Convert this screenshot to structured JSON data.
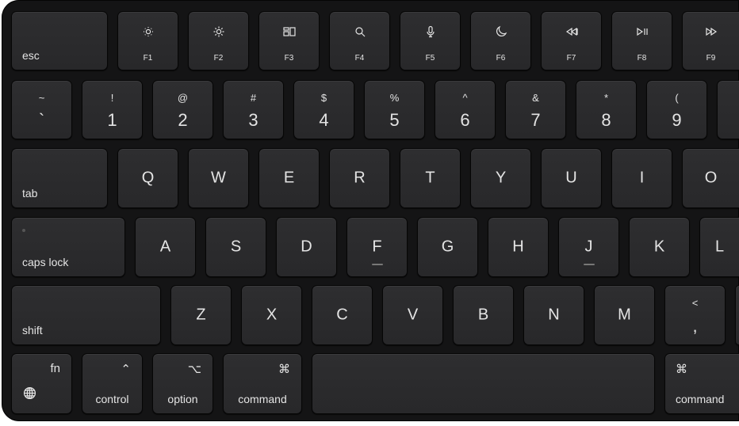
{
  "rows": [
    [
      {
        "label": "esc",
        "type": "wide"
      },
      {
        "label": "F1",
        "icon": "brightness-down-icon",
        "type": "fn"
      },
      {
        "label": "F2",
        "icon": "brightness-up-icon",
        "type": "fn"
      },
      {
        "label": "F3",
        "icon": "mission-control-icon",
        "type": "fn"
      },
      {
        "label": "F4",
        "icon": "search-icon",
        "type": "fn"
      },
      {
        "label": "F5",
        "icon": "microphone-icon",
        "type": "fn"
      },
      {
        "label": "F6",
        "icon": "moon-icon",
        "type": "fn"
      },
      {
        "label": "F7",
        "icon": "rewind-icon",
        "type": "fn"
      },
      {
        "label": "F8",
        "icon": "play-pause-icon",
        "type": "fn"
      },
      {
        "label": "F9",
        "icon": "fast-forward-icon",
        "type": "fn"
      }
    ],
    [
      {
        "top": "~",
        "label": "`",
        "type": "num"
      },
      {
        "top": "!",
        "label": "1",
        "type": "num"
      },
      {
        "top": "@",
        "label": "2",
        "type": "num"
      },
      {
        "top": "#",
        "label": "3",
        "type": "num"
      },
      {
        "top": "$",
        "label": "4",
        "type": "num"
      },
      {
        "top": "%",
        "label": "5",
        "type": "num"
      },
      {
        "top": "^",
        "label": "6",
        "type": "num"
      },
      {
        "top": "&",
        "label": "7",
        "type": "num"
      },
      {
        "top": "*",
        "label": "8",
        "type": "num"
      },
      {
        "top": "(",
        "label": "9",
        "type": "num"
      },
      {
        "top": "",
        "label": "",
        "type": "num"
      }
    ],
    [
      {
        "label": "tab",
        "type": "wide"
      },
      {
        "label": "Q",
        "type": "letter"
      },
      {
        "label": "W",
        "type": "letter"
      },
      {
        "label": "E",
        "type": "letter"
      },
      {
        "label": "R",
        "type": "letter"
      },
      {
        "label": "T",
        "type": "letter"
      },
      {
        "label": "Y",
        "type": "letter"
      },
      {
        "label": "U",
        "type": "letter"
      },
      {
        "label": "I",
        "type": "letter"
      },
      {
        "label": "O",
        "type": "letter"
      }
    ],
    [
      {
        "label": "caps lock",
        "type": "caps"
      },
      {
        "label": "A",
        "type": "letter"
      },
      {
        "label": "S",
        "type": "letter"
      },
      {
        "label": "D",
        "type": "letter"
      },
      {
        "label": "F",
        "type": "letter",
        "bump": true
      },
      {
        "label": "G",
        "type": "letter"
      },
      {
        "label": "H",
        "type": "letter"
      },
      {
        "label": "J",
        "type": "letter",
        "bump": true
      },
      {
        "label": "K",
        "type": "letter"
      },
      {
        "label": "L",
        "type": "letter"
      }
    ],
    [
      {
        "label": "shift",
        "type": "wide"
      },
      {
        "label": "Z",
        "type": "letter"
      },
      {
        "label": "X",
        "type": "letter"
      },
      {
        "label": "C",
        "type": "letter"
      },
      {
        "label": "V",
        "type": "letter"
      },
      {
        "label": "B",
        "type": "letter"
      },
      {
        "label": "N",
        "type": "letter"
      },
      {
        "label": "M",
        "type": "letter"
      },
      {
        "top": "<",
        "label": ",",
        "type": "num"
      },
      {
        "top": "",
        "label": "",
        "type": "num"
      }
    ],
    [
      {
        "top": "fn",
        "icon": "globe-icon",
        "type": "fnkey"
      },
      {
        "top": "⌃",
        "label": "control",
        "type": "mod"
      },
      {
        "top": "⌥",
        "label": "option",
        "type": "mod"
      },
      {
        "top": "⌘",
        "label": "command",
        "type": "mod"
      },
      {
        "label": "",
        "type": "space"
      },
      {
        "top": "⌘",
        "label": "command",
        "type": "modr"
      }
    ]
  ]
}
